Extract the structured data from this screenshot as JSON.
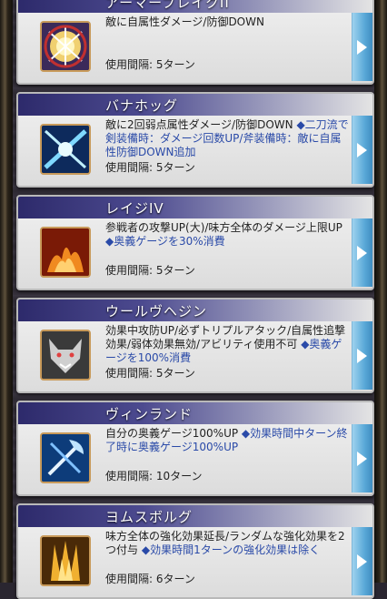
{
  "skills": [
    {
      "name": "アーマーブレイクII",
      "desc": "敵に自属性ダメージ/防御DOWN",
      "desc_extra": "",
      "interval": "使用間隔: 5ターン",
      "icon": "armor-break-icon"
    },
    {
      "name": "バナホッグ",
      "desc": "敵に2回弱点属性ダメージ/防御DOWN",
      "desc_extra": "◆二刀流で剣装備時：ダメージ回数UP/斧装備時：敵に自属性防御DOWN追加",
      "interval": "使用間隔: 5ターン",
      "icon": "banahogg-icon"
    },
    {
      "name": "レイジIV",
      "desc": "参戦者の攻撃UP(大)/味方全体のダメージ上限UP",
      "desc_extra": "◆奥義ゲージを30%消費",
      "interval": "使用間隔: 5ターン",
      "icon": "rage-icon"
    },
    {
      "name": "ウールヴヘジン",
      "desc": "効果中攻防UP/必ずトリプルアタック/自属性追撃効果/弱体効果無効/アビリティ使用不可",
      "desc_extra": "◆奥義ゲージを100%消費",
      "interval": "使用間隔: 5ターン",
      "icon": "wolf-icon"
    },
    {
      "name": "ヴィンランド",
      "desc": "自分の奥義ゲージ100%UP",
      "desc_extra": "◆効果時間中ターン終了時に奥義ゲージ100%UP",
      "interval": "使用間隔: 10ターン",
      "icon": "axe-icon"
    },
    {
      "name": "ヨムスボルグ",
      "desc": "味方全体の強化効果延長/ランダムな強化効果を2つ付与",
      "desc_extra": "◆効果時間1ターンの強化効果は除く",
      "interval": "使用間隔: 6ターン",
      "icon": "fortress-icon"
    }
  ]
}
